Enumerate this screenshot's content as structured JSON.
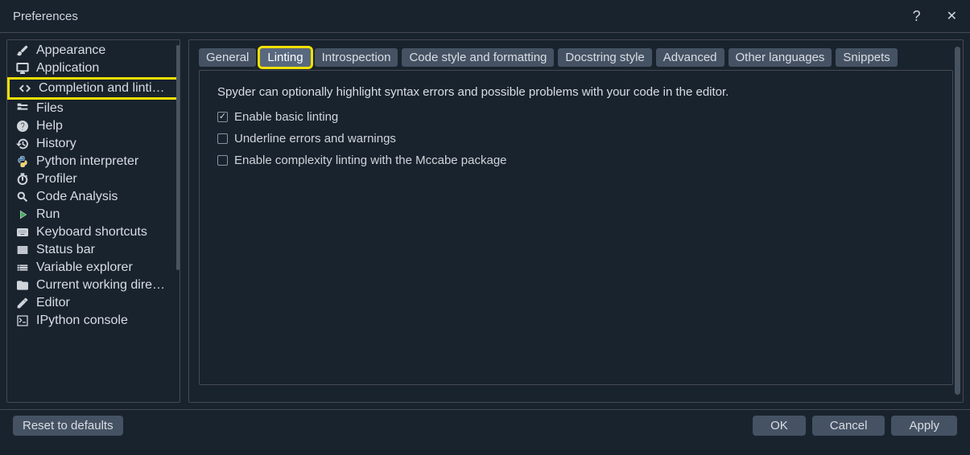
{
  "window": {
    "title": "Preferences"
  },
  "sidebar": {
    "items": [
      {
        "label": "Appearance",
        "icon": "brush-icon"
      },
      {
        "label": "Application",
        "icon": "desktop-icon"
      },
      {
        "label": "Completion and linti…",
        "icon": "code-tag-icon",
        "selected": true,
        "highlight": true
      },
      {
        "label": "Files",
        "icon": "file-tree-icon"
      },
      {
        "label": "Help",
        "icon": "help-icon"
      },
      {
        "label": "History",
        "icon": "history-icon"
      },
      {
        "label": "Python interpreter",
        "icon": "python-icon"
      },
      {
        "label": "Profiler",
        "icon": "timer-icon"
      },
      {
        "label": "Code Analysis",
        "icon": "search-code-icon"
      },
      {
        "label": "Run",
        "icon": "play-icon"
      },
      {
        "label": "Keyboard shortcuts",
        "icon": "keyboard-icon"
      },
      {
        "label": "Status bar",
        "icon": "statusbar-icon"
      },
      {
        "label": "Variable explorer",
        "icon": "list-icon"
      },
      {
        "label": "Current working dire…",
        "icon": "folder-icon"
      },
      {
        "label": "Editor",
        "icon": "pencil-icon"
      },
      {
        "label": "IPython console",
        "icon": "console-icon"
      }
    ]
  },
  "tabs": [
    {
      "label": "General"
    },
    {
      "label": "Linting",
      "active": true,
      "highlight": true
    },
    {
      "label": "Introspection"
    },
    {
      "label": "Code style and formatting"
    },
    {
      "label": "Docstring style"
    },
    {
      "label": "Advanced"
    },
    {
      "label": "Other languages"
    },
    {
      "label": "Snippets"
    }
  ],
  "panel": {
    "description": "Spyder can optionally highlight syntax errors and possible problems with your code in the editor.",
    "options": [
      {
        "label": "Enable basic linting",
        "checked": true
      },
      {
        "label": "Underline errors and warnings",
        "checked": false
      },
      {
        "label": "Enable complexity linting with the Mccabe package",
        "checked": false
      }
    ]
  },
  "buttons": {
    "reset": "Reset to defaults",
    "ok": "OK",
    "cancel": "Cancel",
    "apply": "Apply"
  }
}
